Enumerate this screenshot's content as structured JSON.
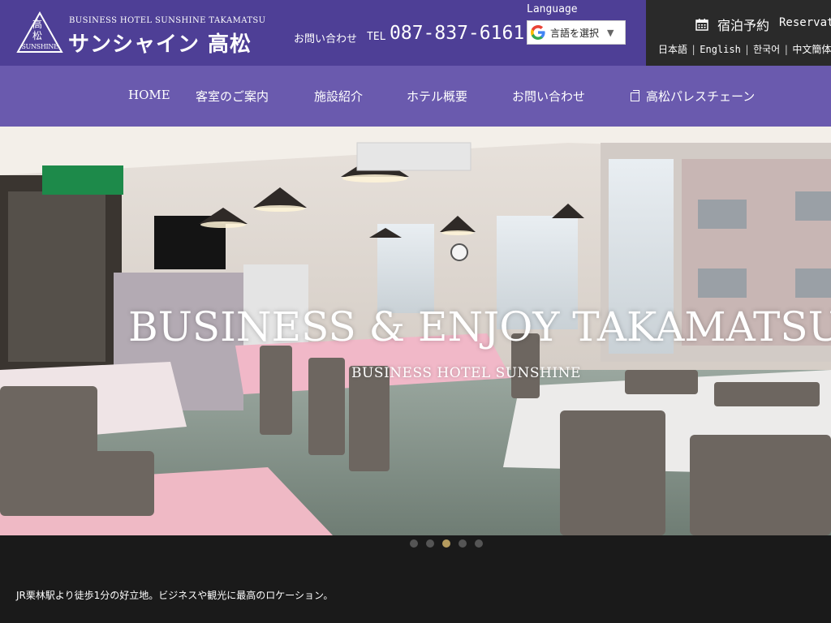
{
  "header": {
    "logo": {
      "kanji_top": "高",
      "kanji_bottom": "松",
      "text": "SUNSHINE"
    },
    "brand_en": "BUSINESS HOTEL SUNSHINE TAKAMATSU",
    "brand_ja": "サンシャイン 高松",
    "contact_label": "お問い合わせ",
    "tel_label": "TEL",
    "tel_number": "087-837-6161",
    "language_label": "Language",
    "language_select": "言語を選択",
    "reservation_ja": "宿泊予約",
    "reservation_en": "Reservati",
    "lang_links": [
      "日本語",
      "English",
      "한국어",
      "中文簡体"
    ]
  },
  "nav": {
    "items": [
      "HOME",
      "客室のご案内",
      "施設紹介",
      "ホテル概要",
      "お問い合わせ",
      "高松パレスチェーン"
    ]
  },
  "hero": {
    "caption": "BUSINESS & ENJOY TAKAMATSU",
    "subcaption": "BUSINESS HOTEL SUNSHINE",
    "slide_count": 5,
    "active_slide": 3
  },
  "footer": {
    "text": "JR栗林駅より徒歩1分の好立地。ビジネスや観光に最高のロケーション。"
  },
  "colors": {
    "header_bg": "#4e3f96",
    "nav_bg": "#6a5aae",
    "reserve_bg": "#2a2a2a",
    "dot_active": "#b59b5e"
  }
}
